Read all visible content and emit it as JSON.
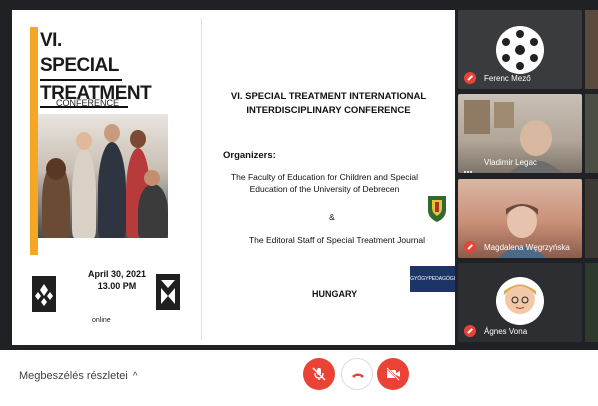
{
  "slide": {
    "title_line1": "VI. SPECIAL",
    "title_line2": "TREATMENT",
    "subtitle": "CONFERENCE",
    "date": "April 30, 2021",
    "time": "13.00 PM",
    "mode": "online",
    "conference_title_line1": "VI. SPECIAL TREATMENT INTERNATIONAL",
    "conference_title_line2": "INTERDISCIPLINARY CONFERENCE",
    "organizers_label": "Organizers:",
    "organizer1_line1": "The Faculty of Education for Children and Special",
    "organizer1_line2": "Education of the University of Debrecen",
    "ampersand": "&",
    "organizer2": "The Editoral Staff of Special Treatment Journal",
    "country": "HUNGARY",
    "journal_logo_text": "GYÓGYPEDAGÓGIAI"
  },
  "participants": [
    {
      "name": "Ferenc Mező",
      "mic": "muted"
    },
    {
      "name": "Vladimir Legac",
      "mic": "speaking"
    },
    {
      "name": "Magdalena Węgrzyńska",
      "mic": "muted"
    },
    {
      "name": "Ágnes Vona",
      "mic": "muted"
    }
  ],
  "bottom_bar": {
    "meeting_details_label": "Megbeszélés részletei",
    "controls": [
      "mic-off-icon",
      "hang-up-icon",
      "camera-off-icon"
    ]
  },
  "colors": {
    "accent": "#f5a623",
    "muted_red": "#ea4335",
    "tile_bg": "#202124",
    "journal_blue": "#1d3566"
  }
}
